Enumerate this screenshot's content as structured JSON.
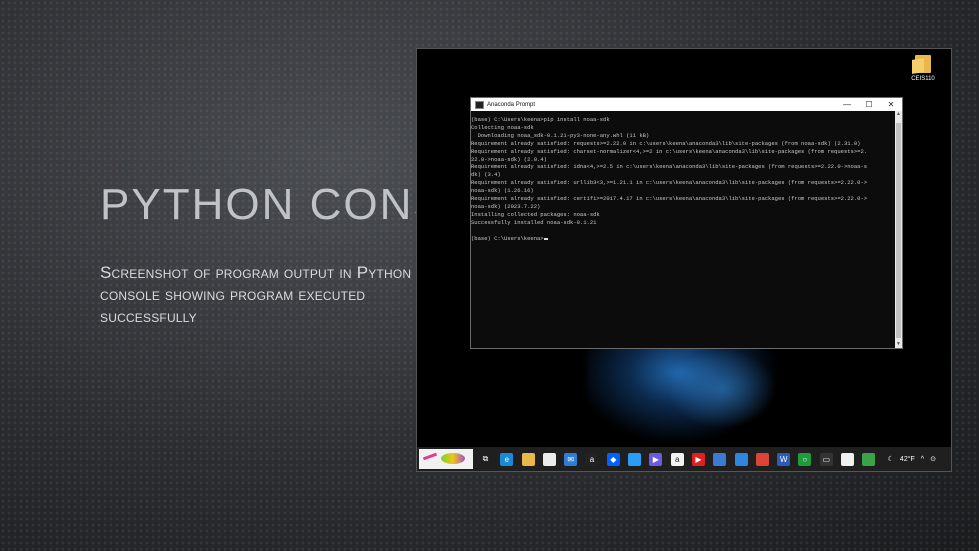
{
  "slide": {
    "title": "Python Cons",
    "subtitle": "Screenshot of program output in Python console showing program executed successfully"
  },
  "desktop": {
    "folder_label": "CEIS110"
  },
  "window": {
    "title": "Anaconda Prompt",
    "minimize": "—",
    "maximize": "☐",
    "close": "✕"
  },
  "terminal": {
    "lines": [
      "(base) C:\\Users\\keena>pip install noaa-sdk",
      "Collecting noaa-sdk",
      "  Downloading noaa_sdk-0.1.21-py3-none-any.whl (11 kB)",
      "Requirement already satisfied: requests>=2.22.0 in c:\\users\\keena\\anaconda3\\lib\\site-packages (from noaa-sdk) (2.31.0)",
      "Requirement already satisfied: charset-normalizer<4,>=2 in c:\\users\\keena\\anaconda3\\lib\\site-packages (from requests>=2.",
      "22.0->noaa-sdk) (2.0.4)",
      "Requirement already satisfied: idna<4,>=2.5 in c:\\users\\keena\\anaconda3\\lib\\site-packages (from requests>=2.22.0->noaa-s",
      "dk) (3.4)",
      "Requirement already satisfied: urllib3<3,>=1.21.1 in c:\\users\\keena\\anaconda3\\lib\\site-packages (from requests>=2.22.0->",
      "noaa-sdk) (1.26.16)",
      "Requirement already satisfied: certifi>=2017.4.17 in c:\\users\\keena\\anaconda3\\lib\\site-packages (from requests>=2.22.0->",
      "noaa-sdk) (2023.7.22)",
      "Installing collected packages: noaa-sdk",
      "Successfully installed noaa-sdk-0.1.21",
      "",
      "(base) C:\\Users\\keena>"
    ]
  },
  "taskbar": {
    "icons": [
      {
        "name": "task-view-icon",
        "color": "#1f1f1f",
        "glyph": "⧉"
      },
      {
        "name": "edge-icon",
        "color": "#1a8ad4",
        "glyph": "e"
      },
      {
        "name": "file-explorer-icon",
        "color": "#e8b84a",
        "glyph": ""
      },
      {
        "name": "news-icon",
        "color": "#ececec",
        "glyph": ""
      },
      {
        "name": "mail-icon",
        "color": "#2f7dd6",
        "glyph": "✉"
      },
      {
        "name": "amazon-icon",
        "color": "#222222",
        "glyph": "a"
      },
      {
        "name": "dropbox-icon",
        "color": "#0061fe",
        "glyph": "◆"
      },
      {
        "name": "cloud-app-icon",
        "color": "#2a9df4",
        "glyph": ""
      },
      {
        "name": "media-player-icon",
        "color": "#6b5be0",
        "glyph": "▶"
      },
      {
        "name": "amazon-app-icon",
        "color": "#f2f2f2",
        "glyph": "a"
      },
      {
        "name": "youtube-icon",
        "color": "#e02020",
        "glyph": "▶"
      },
      {
        "name": "store-bag-icon",
        "color": "#3b7bd4",
        "glyph": ""
      },
      {
        "name": "store-icon",
        "color": "#2e86de",
        "glyph": ""
      },
      {
        "name": "chrome-icon",
        "color": "#db4437",
        "glyph": ""
      },
      {
        "name": "word-icon",
        "color": "#2b5bb8",
        "glyph": "W"
      },
      {
        "name": "xbox-icon",
        "color": "#1e9c3a",
        "glyph": "○"
      },
      {
        "name": "terminal-icon",
        "color": "#333333",
        "glyph": "▭"
      },
      {
        "name": "jupyter-icon",
        "color": "#f0f0f0",
        "glyph": ""
      },
      {
        "name": "anaconda-icon",
        "color": "#3aa34a",
        "glyph": ""
      }
    ],
    "weather_temp": "42°F",
    "tray_arrow": "^",
    "tray_icon": "⊙"
  },
  "colors": {
    "terminal_bg": "#0c0c0c",
    "terminal_text": "#c9c9c9",
    "slide_text": "#bfc2c6"
  }
}
